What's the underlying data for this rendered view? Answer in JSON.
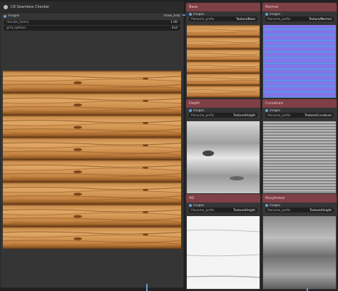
{
  "main_node": {
    "title": "CR Seamless Checker",
    "input_label": "images",
    "right_label": "show_help",
    "widgets": [
      {
        "label": "rescale_factor",
        "value": "1.00"
      },
      {
        "label": "grid_options",
        "value": "2x2"
      }
    ]
  },
  "texture_nodes": [
    {
      "title": "Base",
      "input": "images",
      "prefix_label": "filename_prefix",
      "prefix_value": "Texture/Base"
    },
    {
      "title": "Normal",
      "input": "images",
      "prefix_label": "filename_prefix",
      "prefix_value": "Texture/Normal"
    },
    {
      "title": "Depth",
      "input": "images",
      "prefix_label": "filename_prefix",
      "prefix_value": "Texture/Height"
    },
    {
      "title": "Curvature",
      "input": "images",
      "prefix_label": "filename_prefix",
      "prefix_value": "Texture/Curvature"
    },
    {
      "title": "AO",
      "input": "images",
      "prefix_label": "filename_prefix",
      "prefix_value": "Texture/Height"
    },
    {
      "title": "Roughness",
      "input": "images",
      "prefix_label": "filename_prefix",
      "prefix_value": "Texture/Height"
    }
  ],
  "colors": {
    "node_header": "#7f3f46",
    "link": "#5b8fc6"
  }
}
